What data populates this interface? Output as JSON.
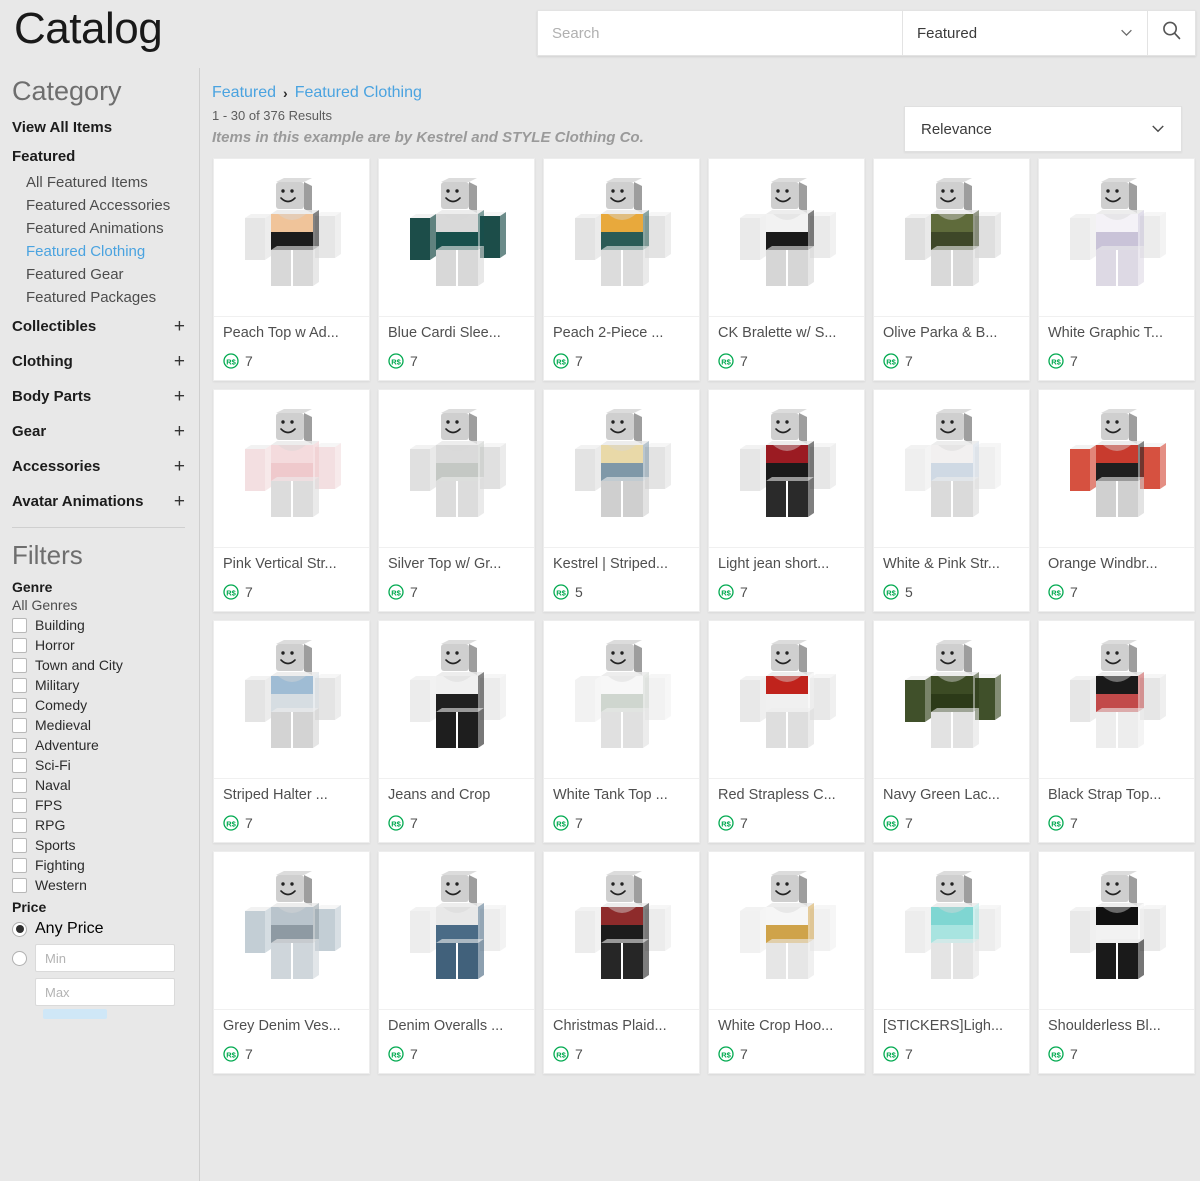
{
  "header": {
    "title": "Catalog",
    "search": {
      "placeholder": "Search",
      "value": ""
    },
    "category_select": "Featured",
    "search_icon": "search-icon",
    "chevron_icon": "chevron-down-icon"
  },
  "sidebar": {
    "category_heading": "Category",
    "view_all": "View All Items",
    "featured_group": {
      "title": "Featured",
      "items": [
        {
          "label": "All Featured Items",
          "active": false
        },
        {
          "label": "Featured Accessories",
          "active": false
        },
        {
          "label": "Featured Animations",
          "active": false
        },
        {
          "label": "Featured Clothing",
          "active": true
        },
        {
          "label": "Featured Gear",
          "active": false
        },
        {
          "label": "Featured Packages",
          "active": false
        }
      ]
    },
    "collapsed_groups": [
      {
        "label": "Collectibles",
        "expander": "+"
      },
      {
        "label": "Clothing",
        "expander": "+"
      },
      {
        "label": "Body Parts",
        "expander": "+"
      },
      {
        "label": "Gear",
        "expander": "+"
      },
      {
        "label": "Accessories",
        "expander": "+"
      },
      {
        "label": "Avatar Animations",
        "expander": "+"
      }
    ],
    "filters": {
      "heading": "Filters",
      "genre_label": "Genre",
      "all_genres": "All Genres",
      "genres": [
        "Building",
        "Horror",
        "Town and City",
        "Military",
        "Comedy",
        "Medieval",
        "Adventure",
        "Sci-Fi",
        "Naval",
        "FPS",
        "RPG",
        "Sports",
        "Fighting",
        "Western"
      ],
      "price_label": "Price",
      "any_price": "Any Price",
      "min_placeholder": "Min",
      "max_placeholder": "Max"
    }
  },
  "content": {
    "breadcrumb": {
      "root": "Featured",
      "separator": "›",
      "current": "Featured Clothing"
    },
    "results_count": "1 - 30 of 376 Results",
    "note": "Items in this example are by Kestrel and STYLE Clothing Co.",
    "sort": {
      "value": "Relevance",
      "chevron_icon": "chevron-down-icon"
    },
    "currency_icon": "robux-icon",
    "accent_color": "#4aa3e0",
    "robux_color": "#00a94f",
    "items": [
      {
        "title": "Peach Top w Ad...",
        "price": "7",
        "shirt": "#f0c49a",
        "shirt2": "#1c1c1c",
        "pants": "#d8d8d8",
        "arm": "#e6e6e6"
      },
      {
        "title": "Blue Cardi Slee...",
        "price": "7",
        "shirt": "#d9d9d9",
        "shirt2": "#17504c",
        "pants": "#d8d8d8",
        "arm": "#1c4d49"
      },
      {
        "title": "Peach 2-Piece ...",
        "price": "7",
        "shirt": "#e8a93c",
        "shirt2": "#2a5b56",
        "pants": "#dcdcdc",
        "arm": "#e3e3e3"
      },
      {
        "title": "CK Bralette w/ S...",
        "price": "7",
        "shirt": "#f2f2f2",
        "shirt2": "#1a1a1a",
        "pants": "#d6d6d6",
        "arm": "#eaeaea"
      },
      {
        "title": "Olive Parka & B...",
        "price": "7",
        "shirt": "#5f6b3b",
        "shirt2": "#3e4728",
        "pants": "#d9d9d9",
        "arm": "#dfdfdf"
      },
      {
        "title": "White Graphic T...",
        "price": "7",
        "shirt": "#f4f2f7",
        "shirt2": "#c9c3d8",
        "pants": "#ddd9e4",
        "arm": "#ececec"
      },
      {
        "title": "Pink Vertical Str...",
        "price": "7",
        "shirt": "#f4dbdd",
        "shirt2": "#efc9cc",
        "pants": "#dcdcdc",
        "arm": "#f3dfe1"
      },
      {
        "title": "Silver Top w/ Gr...",
        "price": "7",
        "shirt": "#dadada",
        "shirt2": "#c4c8c4",
        "pants": "#dcdcdc",
        "arm": "#e0e0e0"
      },
      {
        "title": "Kestrel | Striped...",
        "price": "5",
        "shirt": "#e9d9a8",
        "shirt2": "#7f98a8",
        "pants": "#cfcfcf",
        "arm": "#e3e3e3"
      },
      {
        "title": "Light jean short...",
        "price": "7",
        "shirt": "#9b1b22",
        "shirt2": "#1a1a1a",
        "pants": "#2a2a2a",
        "arm": "#e6e6e6"
      },
      {
        "title": "White & Pink Str...",
        "price": "5",
        "shirt": "#f2f0f0",
        "shirt2": "#cfd9e4",
        "pants": "#dadada",
        "arm": "#efefef"
      },
      {
        "title": "Orange Windbr...",
        "price": "7",
        "shirt": "#c83b2e",
        "shirt2": "#1f1f1f",
        "pants": "#d0d0d0",
        "arm": "#d65140"
      },
      {
        "title": "Striped Halter ...",
        "price": "7",
        "shirt": "#9fbcd4",
        "shirt2": "#d6dde2",
        "pants": "#d3d3d3",
        "arm": "#e4e4e4"
      },
      {
        "title": "Jeans and Crop",
        "price": "7",
        "shirt": "#f0f0f0",
        "shirt2": "#202020",
        "pants": "#1e1e1e",
        "arm": "#ececec"
      },
      {
        "title": "White Tank Top ...",
        "price": "7",
        "shirt": "#f7f7f7",
        "shirt2": "#cfd6cf",
        "pants": "#e0e0e0",
        "arm": "#f2f2f2"
      },
      {
        "title": "Red Strapless C...",
        "price": "7",
        "shirt": "#c0231c",
        "shirt2": "#f0f0f0",
        "pants": "#dedede",
        "arm": "#e8e8e8"
      },
      {
        "title": "Navy Green Lac...",
        "price": "7",
        "shirt": "#3c4b24",
        "shirt2": "#2c3a18",
        "pants": "#e2e2e2",
        "arm": "#40502a"
      },
      {
        "title": "Black Strap Top...",
        "price": "7",
        "shirt": "#1a1a1a",
        "shirt2": "#c24a4a",
        "pants": "#ededed",
        "arm": "#e6e6e6"
      },
      {
        "title": "Grey Denim Ves...",
        "price": "7",
        "shirt": "#b9c4cc",
        "shirt2": "#8e9aa3",
        "pants": "#cfd6db",
        "arm": "#c3ced5"
      },
      {
        "title": "Denim Overalls ...",
        "price": "7",
        "shirt": "#e8e8e8",
        "shirt2": "#4a6b86",
        "pants": "#41617b",
        "arm": "#ededed"
      },
      {
        "title": "Christmas Plaid...",
        "price": "7",
        "shirt": "#8e2b2b",
        "shirt2": "#1c1c1c",
        "pants": "#262626",
        "arm": "#ececec"
      },
      {
        "title": "White Crop Hoo...",
        "price": "7",
        "shirt": "#f6f6f6",
        "shirt2": "#cfa34a",
        "pants": "#e6e6e6",
        "arm": "#f1f1f1"
      },
      {
        "title": "[STICKERS]Ligh...",
        "price": "7",
        "shirt": "#7fd6d2",
        "shirt2": "#a8e4e0",
        "pants": "#e4e4e4",
        "arm": "#ededed"
      },
      {
        "title": "Shoulderless Bl...",
        "price": "7",
        "shirt": "#111111",
        "shirt2": "#f2f2f2",
        "pants": "#1a1a1a",
        "arm": "#e9e9e9"
      }
    ]
  }
}
